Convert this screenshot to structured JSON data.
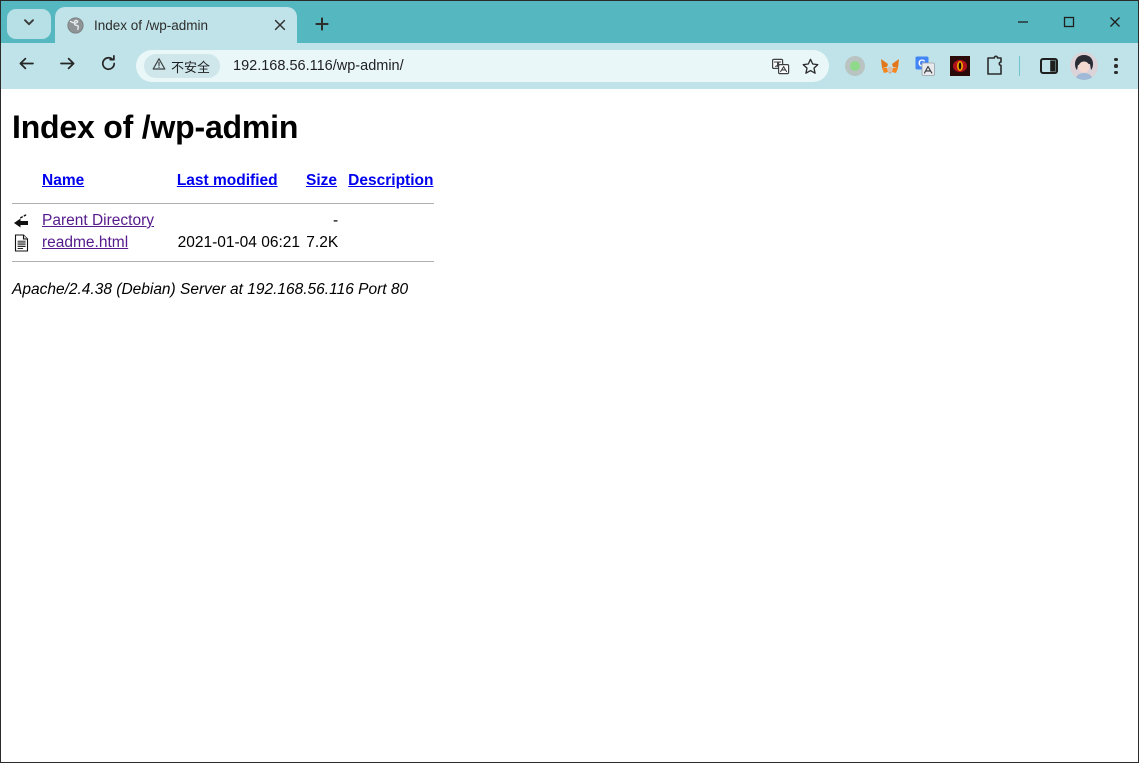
{
  "browser": {
    "tab_search_icon": "chevron-down-icon",
    "tab": {
      "favicon": "globe-icon",
      "title": "Index of /wp-admin",
      "close_icon": "close-icon"
    },
    "new_tab_label": "+",
    "window_controls": {
      "minimize": "minimize-icon",
      "maximize": "maximize-icon",
      "close": "close-icon"
    },
    "nav": {
      "back": "back-arrow-icon",
      "forward": "forward-arrow-icon",
      "reload": "reload-icon"
    },
    "omnibox": {
      "security_icon": "warning-triangle-icon",
      "security_label": "不安全",
      "url": "192.168.56.116/wp-admin/",
      "translate_icon": "translate-icon",
      "bookmark_icon": "star-icon"
    },
    "extensions": [
      {
        "name": "green-circle-extension-icon"
      },
      {
        "name": "metamask-fox-icon"
      },
      {
        "name": "google-translate-extension-icon"
      },
      {
        "name": "dark-red-eye-extension-icon"
      },
      {
        "name": "puzzle-piece-extensions-icon"
      }
    ],
    "side_panel_icon": "side-panel-icon",
    "profile_avatar": "avatar-icon",
    "menu_icon": "three-dot-menu-icon",
    "colors": {
      "titlebar": "#55b7c0",
      "toolbar": "#bfe3e8",
      "tab_active": "#bfe3e8",
      "omnibox": "#eaf7f9",
      "link": "#0000ee",
      "visited_link": "#551a8b"
    }
  },
  "page": {
    "title": "Index of /wp-admin",
    "headers": {
      "name": "Name",
      "last_modified": "Last modified",
      "size": "Size",
      "description": "Description"
    },
    "rows": [
      {
        "icon": "parent-directory-icon",
        "name": "Parent Directory",
        "last_modified": "",
        "size": "-",
        "description": ""
      },
      {
        "icon": "text-document-icon",
        "name": "readme.html",
        "last_modified": "2021-01-04 06:21",
        "size": "7.2K",
        "description": ""
      }
    ],
    "signature": "Apache/2.4.38 (Debian) Server at 192.168.56.116 Port 80"
  }
}
